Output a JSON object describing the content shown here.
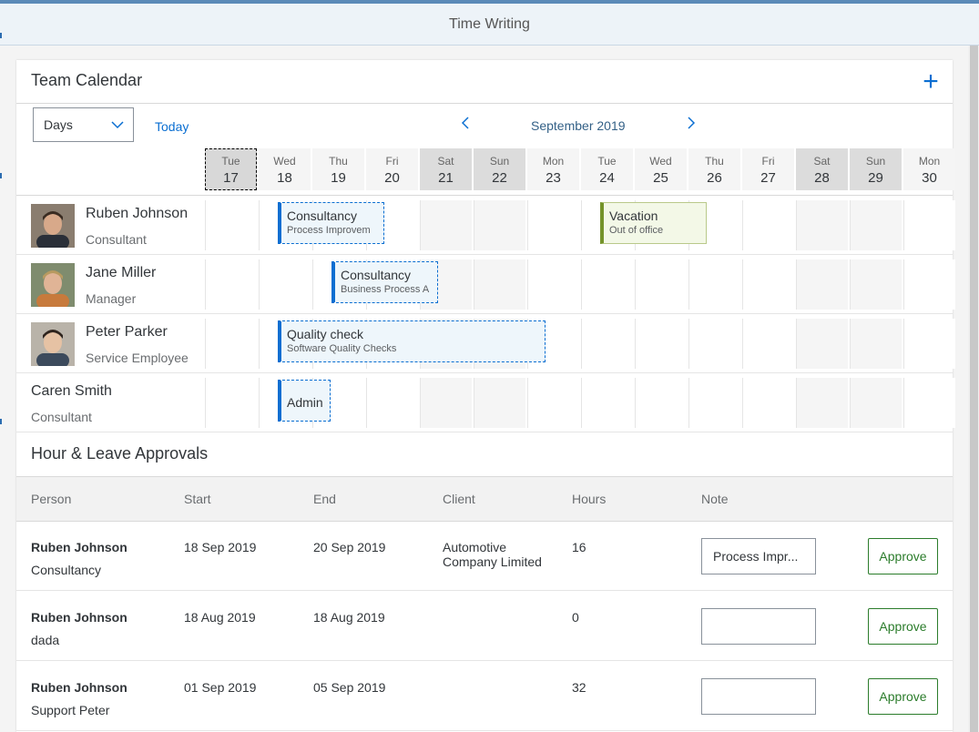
{
  "shell": {
    "title": "Time Writing"
  },
  "calendar": {
    "title": "Team Calendar",
    "add_icon": "plus-icon",
    "view_select": {
      "selected": "Days"
    },
    "today_label": "Today",
    "month_label": "September 2019",
    "days": [
      {
        "dow": "Tue",
        "num": "17",
        "weekend": false,
        "selected": true
      },
      {
        "dow": "Wed",
        "num": "18",
        "weekend": false
      },
      {
        "dow": "Thu",
        "num": "19",
        "weekend": false
      },
      {
        "dow": "Fri",
        "num": "20",
        "weekend": false
      },
      {
        "dow": "Sat",
        "num": "21",
        "weekend": true
      },
      {
        "dow": "Sun",
        "num": "22",
        "weekend": true
      },
      {
        "dow": "Mon",
        "num": "23",
        "weekend": false
      },
      {
        "dow": "Tue",
        "num": "24",
        "weekend": false
      },
      {
        "dow": "Wed",
        "num": "25",
        "weekend": false
      },
      {
        "dow": "Thu",
        "num": "26",
        "weekend": false
      },
      {
        "dow": "Fri",
        "num": "27",
        "weekend": false
      },
      {
        "dow": "Sat",
        "num": "28",
        "weekend": true
      },
      {
        "dow": "Sun",
        "num": "29",
        "weekend": true
      },
      {
        "dow": "Mon",
        "num": "30",
        "weekend": false
      }
    ],
    "rows": [
      {
        "name": "Ruben Johnson",
        "role": "Consultant",
        "has_avatar": true,
        "appointments": [
          {
            "title": "Consultancy",
            "subtitle": "Process Improvem",
            "start": 1,
            "span": 2,
            "type": "work"
          },
          {
            "title": "Vacation",
            "subtitle": "Out of office",
            "start": 7,
            "span": 2,
            "type": "vacation"
          }
        ]
      },
      {
        "name": "Jane Miller",
        "role": "Manager",
        "has_avatar": true,
        "appointments": [
          {
            "title": "Consultancy",
            "subtitle": "Business Process A",
            "start": 2,
            "span": 2,
            "type": "work"
          }
        ]
      },
      {
        "name": "Peter Parker",
        "role": "Service Employee",
        "has_avatar": true,
        "appointments": [
          {
            "title": "Quality check",
            "subtitle": "Software Quality Checks",
            "start": 1,
            "span": 5,
            "type": "work"
          }
        ]
      },
      {
        "name": "Caren Smith",
        "role": "Consultant",
        "has_avatar": false,
        "appointments": [
          {
            "title": "Admin",
            "subtitle": "",
            "start": 1,
            "span": 1,
            "type": "work"
          }
        ]
      }
    ]
  },
  "approvals": {
    "title": "Hour & Leave Approvals",
    "columns": [
      "Person",
      "Start",
      "End",
      "Client",
      "Hours",
      "Note"
    ],
    "rows": [
      {
        "person": "Ruben Johnson",
        "task": "Consultancy",
        "start": "18 Sep 2019",
        "end": "20 Sep 2019",
        "client_line1": "Automotive",
        "client_line2": "Company Limited",
        "hours": "16",
        "note": "Process Impr...",
        "approve_label": "Approve"
      },
      {
        "person": "Ruben Johnson",
        "task": "dada",
        "start": "18 Aug 2019",
        "end": "18 Aug 2019",
        "client_line1": "",
        "client_line2": "",
        "hours": "0",
        "note": "",
        "approve_label": "Approve"
      },
      {
        "person": "Ruben Johnson",
        "task": "Support Peter",
        "start": "01 Sep 2019",
        "end": "05 Sep 2019",
        "client_line1": "",
        "client_line2": "",
        "hours": "32",
        "note": "",
        "approve_label": "Approve"
      }
    ]
  },
  "colors": {
    "accent": "#0a6ed1",
    "vacation": "#74932a",
    "approve": "#2b7c2b"
  }
}
